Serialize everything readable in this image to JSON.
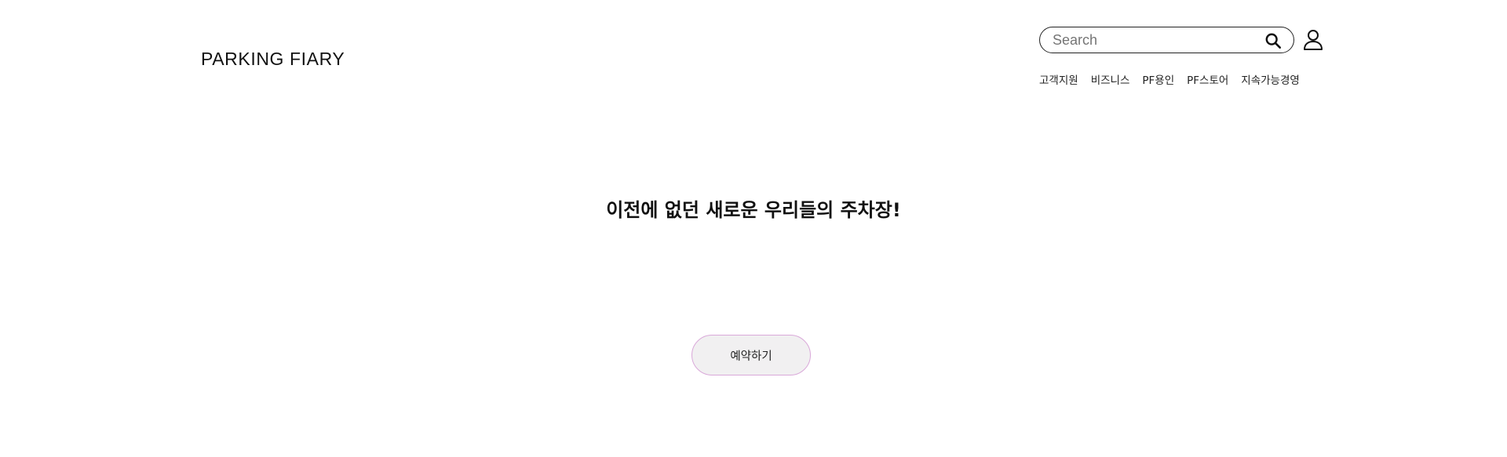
{
  "header": {
    "logo": "PARKING FIARY",
    "search": {
      "placeholder": "Search",
      "value": "",
      "icon": "search-icon"
    },
    "user_icon": "user-icon",
    "nav": [
      {
        "label": "고객지원"
      },
      {
        "label": "비즈니스"
      },
      {
        "label": "PF용인"
      },
      {
        "label": "PF스토어"
      },
      {
        "label": "지속가능경영"
      }
    ]
  },
  "main": {
    "headline": "이전에 없던 새로운 우리들의 주차장!",
    "reserve_button": "예약하기"
  },
  "colors": {
    "button_border": "#d9a8d9",
    "button_background": "#f1f0f1",
    "text": "#111111"
  }
}
